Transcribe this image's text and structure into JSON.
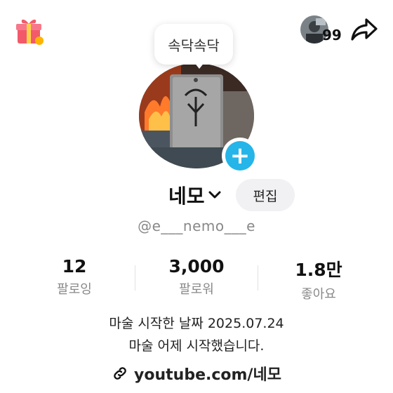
{
  "header": {
    "gift_icon": "gift-icon",
    "friends_count": "99",
    "share_icon": "share-icon"
  },
  "tooltip": {
    "text": "속닥속닥"
  },
  "profile": {
    "name": "네모",
    "edit_label": "편집",
    "handle": "@e___nemo___e",
    "add_icon": "plus-icon",
    "accent": "#25b5e8"
  },
  "stats": [
    {
      "value": "12",
      "label": "팔로잉"
    },
    {
      "value": "3,000",
      "label": "팔로워"
    },
    {
      "value": "1.8만",
      "label": "좋아요"
    }
  ],
  "bio": {
    "line1": "마술 시작한 날짜 2025.07.24",
    "line2": "마술 어제 시작했습니다."
  },
  "link": {
    "text": "youtube.com/네모",
    "icon": "link-icon"
  }
}
